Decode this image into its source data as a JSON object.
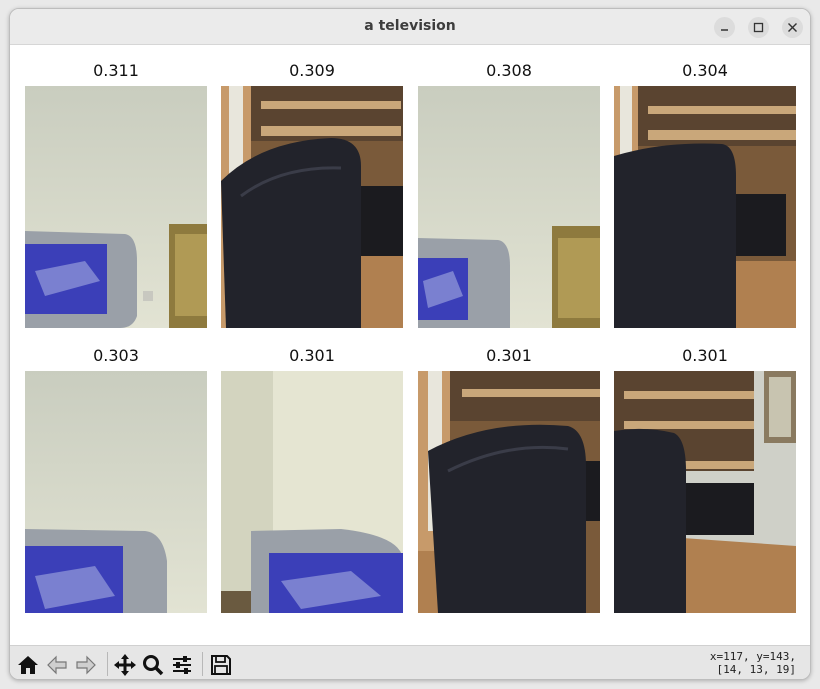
{
  "window": {
    "title": "a television",
    "buttons": [
      "minimize",
      "maximize",
      "close"
    ]
  },
  "results": [
    {
      "score": "0.311",
      "scene": "tv-left-cabinet"
    },
    {
      "score": "0.309",
      "scene": "chair-shelf"
    },
    {
      "score": "0.308",
      "scene": "tv-left-cabinet"
    },
    {
      "score": "0.304",
      "scene": "chair-shelf"
    },
    {
      "score": "0.303",
      "scene": "tv-bottom"
    },
    {
      "score": "0.301",
      "scene": "tv-corner"
    },
    {
      "score": "0.301",
      "scene": "chair-shelf"
    },
    {
      "score": "0.301",
      "scene": "chair-desk-monitor"
    }
  ],
  "toolbar": {
    "icons": [
      "home-icon",
      "back-icon",
      "forward-icon",
      "pan-icon",
      "zoom-icon",
      "configure-subplots-icon",
      "save-icon"
    ]
  },
  "status": {
    "coords_line1": "x=117, y=143,",
    "coords_line2": "[14, 13, 19]"
  },
  "colors": {
    "titlebar": "#ebebeb",
    "toolbar": "#e6e6e6",
    "wall": "#d9dcc9",
    "tv_screen": "#3a3fb0"
  }
}
